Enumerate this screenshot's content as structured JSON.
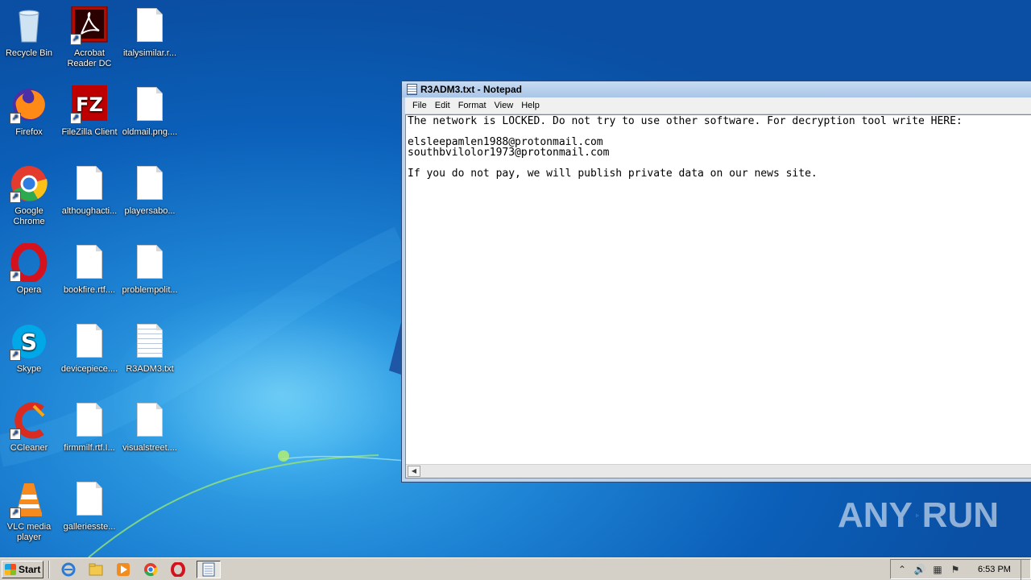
{
  "desktop": {
    "icons": [
      {
        "label": "Recycle Bin",
        "icon": "recycle-bin-icon"
      },
      {
        "label": "Acrobat Reader DC",
        "icon": "acrobat-icon"
      },
      {
        "label": "italysimilar.r...",
        "icon": "document-icon"
      },
      {
        "label": "Firefox",
        "icon": "firefox-icon"
      },
      {
        "label": "FileZilla Client",
        "icon": "filezilla-icon"
      },
      {
        "label": "oldmail.png....",
        "icon": "document-icon"
      },
      {
        "label": "Google Chrome",
        "icon": "chrome-icon"
      },
      {
        "label": "althoughacti...",
        "icon": "document-icon"
      },
      {
        "label": "playersabo...",
        "icon": "document-icon"
      },
      {
        "label": "Opera",
        "icon": "opera-icon"
      },
      {
        "label": "bookfire.rtf....",
        "icon": "document-icon"
      },
      {
        "label": "problempolit...",
        "icon": "document-icon"
      },
      {
        "label": "Skype",
        "icon": "skype-icon"
      },
      {
        "label": "devicepiece....",
        "icon": "document-icon"
      },
      {
        "label": "R3ADM3.txt",
        "icon": "text-file-icon"
      },
      {
        "label": "CCleaner",
        "icon": "ccleaner-icon"
      },
      {
        "label": "firmmilf.rtf.I...",
        "icon": "document-icon"
      },
      {
        "label": "visualstreet....",
        "icon": "document-icon"
      },
      {
        "label": "VLC media player",
        "icon": "vlc-icon"
      },
      {
        "label": "galleriesste...",
        "icon": "document-icon"
      }
    ]
  },
  "notepad": {
    "title": "R3ADM3.txt - Notepad",
    "menu": [
      "File",
      "Edit",
      "Format",
      "View",
      "Help"
    ],
    "content": "The network is LOCKED. Do not try to use other software. For decryption tool write HERE:\n\nelsleepamlen1988@protonmail.com\nsouthbvilolor1973@protonmail.com\n\nIf you do not pay, we will publish private data on our news site."
  },
  "taskbar": {
    "start_label": "Start",
    "pinned": [
      "internet-explorer-icon",
      "explorer-folder-icon",
      "media-player-icon",
      "chrome-icon",
      "opera-icon",
      "notepad-icon"
    ],
    "clock": "6:53 PM"
  },
  "watermark": {
    "left": "ANY",
    "right": "RUN"
  },
  "colors": {
    "titlebar": "#b9d1ea",
    "taskbar": "#d4d0c8",
    "desktop": "#1f86d6"
  }
}
